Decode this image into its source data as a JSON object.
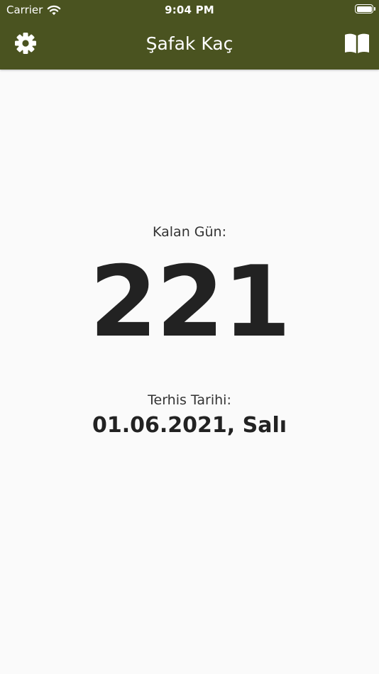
{
  "status_bar": {
    "carrier": "Carrier",
    "time": "9:04 PM",
    "wifi_icon": "wifi-icon",
    "battery_icon": "battery-icon"
  },
  "nav": {
    "title": "Şafak Kaç",
    "left_icon": "gear-icon",
    "right_icon": "book-icon"
  },
  "main": {
    "remaining_label": "Kalan Gün:",
    "remaining_days": "221",
    "discharge_label": "Terhis Tarihi:",
    "discharge_date": "01.06.2021, Salı"
  },
  "colors": {
    "header_bg": "#4a5320",
    "page_bg": "#fafafa",
    "text": "#222222"
  }
}
